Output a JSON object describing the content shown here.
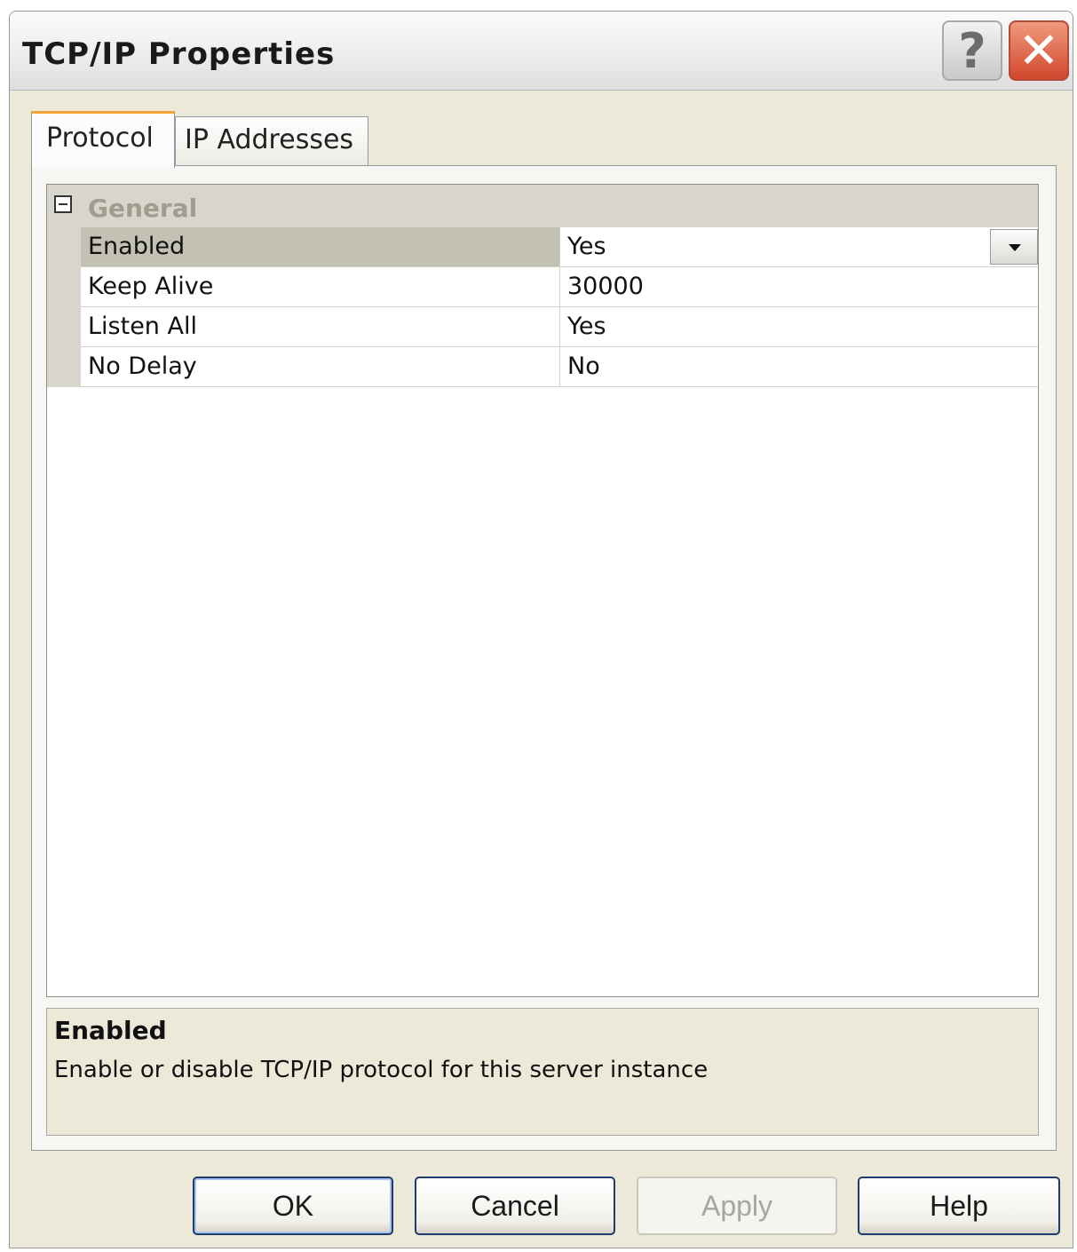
{
  "window": {
    "title": "TCP/IP Properties",
    "help_glyph": "?",
    "close_glyph": "✕"
  },
  "tabs": [
    {
      "label": "Protocol",
      "active": true
    },
    {
      "label": "IP Addresses",
      "active": false
    }
  ],
  "grid": {
    "category": "General",
    "category_expanded": true,
    "rows": [
      {
        "name": "Enabled",
        "value": "Yes",
        "selected": true,
        "has_dropdown": true
      },
      {
        "name": "Keep Alive",
        "value": "30000",
        "selected": false
      },
      {
        "name": "Listen All",
        "value": "Yes",
        "selected": false
      },
      {
        "name": "No Delay",
        "value": "No",
        "selected": false
      }
    ]
  },
  "description": {
    "title": "Enabled",
    "text": "Enable or disable TCP/IP protocol for this server instance"
  },
  "buttons": {
    "ok": "OK",
    "cancel": "Cancel",
    "apply": "Apply",
    "help": "Help"
  },
  "colors": {
    "dialog_bg": "#ece9d8",
    "selected_row": "#c3c0b4",
    "close_button": "#d2472e",
    "active_tab_accent": "#f2a43a"
  }
}
